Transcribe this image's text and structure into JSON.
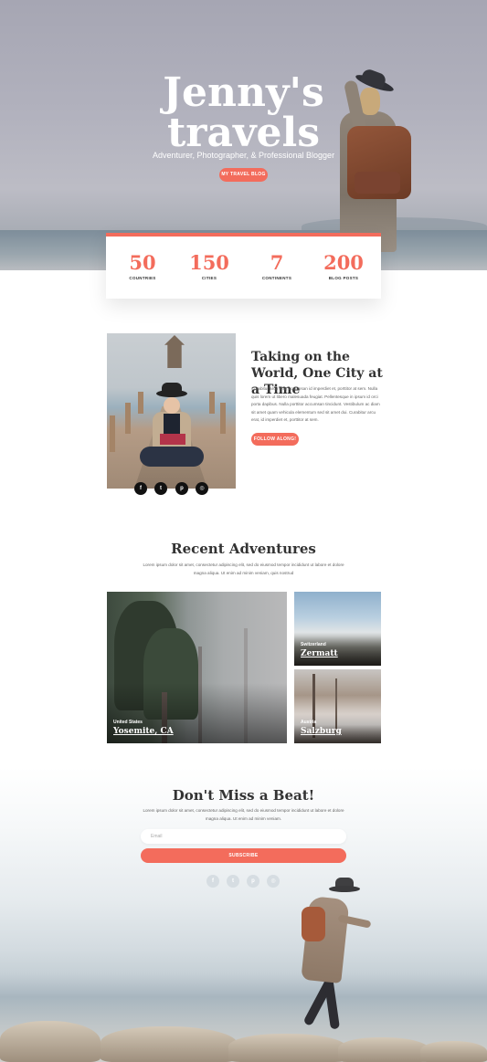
{
  "hero": {
    "title_line1": "Jenny's",
    "title_line2": "travels",
    "subtitle": "Adventurer, Photographer, & Professional Blogger",
    "button": "MY TRAVEL BLOG"
  },
  "stats": [
    {
      "value": "50",
      "label": "COUNTRIES"
    },
    {
      "value": "150",
      "label": "CITIES"
    },
    {
      "value": "7",
      "label": "CONTINENTS"
    },
    {
      "value": "200",
      "label": "BLOG POSTS"
    }
  ],
  "about": {
    "title": "Taking on the World, One City at a Time",
    "text": "Curabitur arcu erat, accumsan id imperdiet et, porttitor at sem. Nulla quis lorem ut libero malesuada feugiat. Pellentesque in ipsum id orci porta dapibus. Nulla porttitor accumsan tincidunt. Vestibulum ac diam sit amet quam vehicula elementum sed sit amet dui. Curabitur arcu erat, id imperdiet et, porttitor at sem.",
    "button": "FOLLOW ALONG!",
    "social": [
      {
        "icon": "facebook-icon",
        "glyph": "f"
      },
      {
        "icon": "twitter-icon",
        "glyph": "t"
      },
      {
        "icon": "pinterest-icon",
        "glyph": "p"
      },
      {
        "icon": "instagram-icon",
        "glyph": "◎"
      }
    ]
  },
  "adventures": {
    "title": "Recent Adventures",
    "text": "Lorem ipsum dolor sit amet, consectetur adipiscing elit, sed do eiusmod tempor incididunt ut labore et dolore magna aliqua. Ut enim ad minim veniam, quis nostrud",
    "cards": [
      {
        "country": "United States",
        "city": "Yosemite, CA"
      },
      {
        "country": "Switzerland",
        "city": "Zermatt"
      },
      {
        "country": "Austria",
        "city": "Salzburg"
      }
    ]
  },
  "newsletter": {
    "title": "Don't Miss a Beat!",
    "text": "Lorem ipsum dolor sit amet, consectetur adipiscing elit, sed do eiusmod tempor incididunt ut labore et dolore magna aliqua. Ut enim ad minim veniam.",
    "email_placeholder": "Email",
    "button": "SUBSCRIBE",
    "social": [
      "f",
      "t",
      "p",
      "◎"
    ]
  },
  "colors": {
    "accent": "#f36c5c",
    "text": "#333333"
  }
}
